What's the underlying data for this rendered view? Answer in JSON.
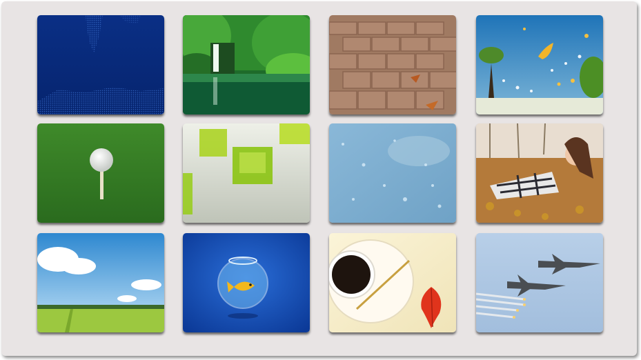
{
  "gallery": {
    "tiles": [
      {
        "name": "world-map"
      },
      {
        "name": "waterfall"
      },
      {
        "name": "brick-pavement"
      },
      {
        "name": "butterflies-tree"
      },
      {
        "name": "golf-ball"
      },
      {
        "name": "green-cubes"
      },
      {
        "name": "raindrops"
      },
      {
        "name": "girl-leaves"
      },
      {
        "name": "green-field"
      },
      {
        "name": "goldfish-bowl"
      },
      {
        "name": "coffee-leaf"
      },
      {
        "name": "fighter-jets"
      }
    ]
  }
}
